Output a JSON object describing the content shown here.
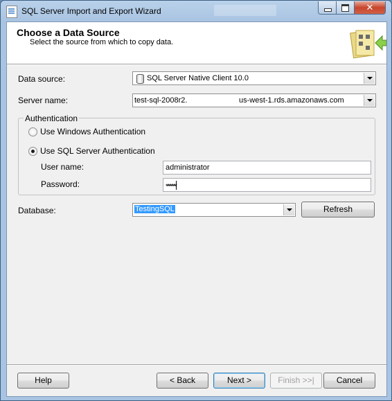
{
  "window": {
    "title": "SQL Server Import and Export Wizard"
  },
  "header": {
    "title": "Choose a Data Source",
    "subtitle": "Select the source from which to copy data."
  },
  "form": {
    "data_source": {
      "label": "Data source:",
      "value": "SQL Server Native Client 10.0"
    },
    "server_name": {
      "label": "Server name:",
      "value_start": "test-sql-2008r2.",
      "value_end": "us-west-1.rds.amazonaws.com"
    },
    "authentication": {
      "legend": "Authentication",
      "windows_option": "Use Windows Authentication",
      "sql_option": "Use SQL Server Authentication",
      "selected": "sql",
      "username_label": "User name:",
      "username_value": "administrator",
      "password_label": "Password:",
      "password_value": "**********"
    },
    "database": {
      "label": "Database:",
      "value": "TestingSQL"
    },
    "refresh_label": "Refresh"
  },
  "footer": {
    "help": "Help",
    "back": "< Back",
    "next": "Next >",
    "finish": "Finish >>|",
    "cancel": "Cancel"
  }
}
